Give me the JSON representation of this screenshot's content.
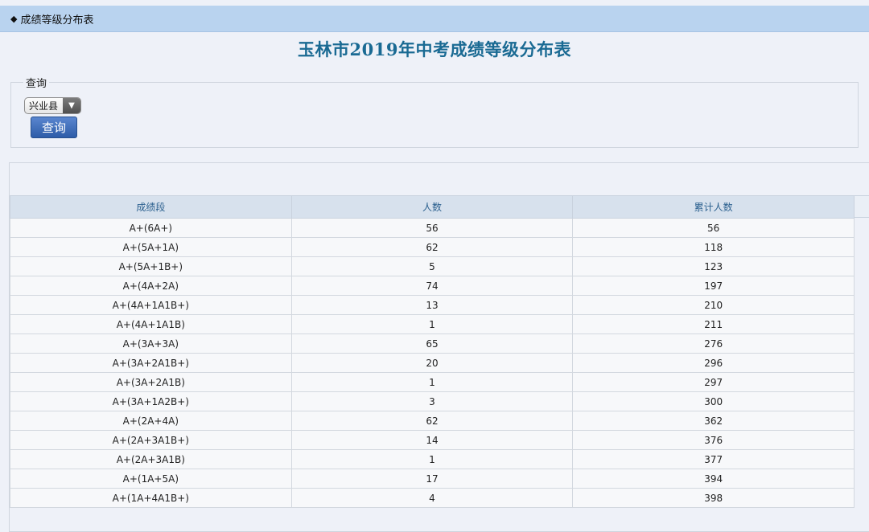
{
  "nav": {
    "marker": "◆",
    "breadcrumb": "成绩等级分布表"
  },
  "page_title": "玉林市2019年中考成绩等级分布表",
  "query": {
    "legend": "查询",
    "county_selected": "兴业县",
    "button_label": "查询"
  },
  "table": {
    "headers": [
      "成绩段",
      "人数",
      "累计人数"
    ],
    "rows": [
      [
        "A+(6A+)",
        "56",
        "56"
      ],
      [
        "A+(5A+1A)",
        "62",
        "118"
      ],
      [
        "A+(5A+1B+)",
        "5",
        "123"
      ],
      [
        "A+(4A+2A)",
        "74",
        "197"
      ],
      [
        "A+(4A+1A1B+)",
        "13",
        "210"
      ],
      [
        "A+(4A+1A1B)",
        "1",
        "211"
      ],
      [
        "A+(3A+3A)",
        "65",
        "276"
      ],
      [
        "A+(3A+2A1B+)",
        "20",
        "296"
      ],
      [
        "A+(3A+2A1B)",
        "1",
        "297"
      ],
      [
        "A+(3A+1A2B+)",
        "3",
        "300"
      ],
      [
        "A+(2A+4A)",
        "62",
        "362"
      ],
      [
        "A+(2A+3A1B+)",
        "14",
        "376"
      ],
      [
        "A+(2A+3A1B)",
        "1",
        "377"
      ],
      [
        "A+(1A+5A)",
        "17",
        "394"
      ],
      [
        "A+(1A+4A1B+)",
        "4",
        "398"
      ]
    ]
  },
  "colors": {
    "nav_bar": "#b9d3ef",
    "title": "#1a6a93",
    "table_header_bg": "#d7e1ed",
    "table_header_text": "#2a5f8e",
    "button": "#2d5ca8"
  }
}
